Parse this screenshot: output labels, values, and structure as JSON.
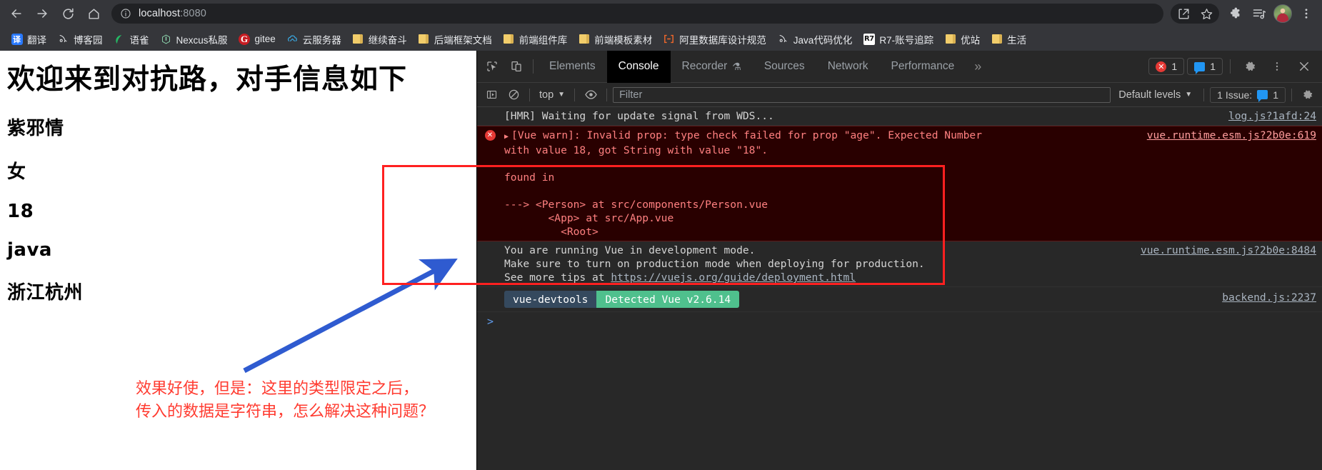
{
  "browser": {
    "nav": {
      "back": "back-arrow",
      "forward": "forward-arrow",
      "reload": "reload",
      "home": "home"
    },
    "omnibox": {
      "info_icon": "site-info-icon",
      "url_host": "localhost",
      "url_port": ":8080",
      "full_url": "localhost:8080"
    },
    "toolbar_right": [
      {
        "name": "share-icon"
      },
      {
        "name": "bookmark-star-icon"
      },
      {
        "name": "extensions-puzzle-icon"
      },
      {
        "name": "media-playlist-icon"
      },
      {
        "name": "profile-avatar"
      },
      {
        "name": "chrome-menu-icon"
      }
    ],
    "bookmarks": [
      {
        "label": "翻译",
        "icon": "translate-icon",
        "glyph": "译"
      },
      {
        "label": "博客园",
        "icon": "cnblogs-icon",
        "glyph": "↘"
      },
      {
        "label": "语雀",
        "icon": "yuque-icon",
        "glyph": "◖"
      },
      {
        "label": "Nexcus私服",
        "icon": "nexus-icon",
        "glyph": "⬡"
      },
      {
        "label": "gitee",
        "icon": "gitee-icon",
        "glyph": "G"
      },
      {
        "label": "云服务器",
        "icon": "cloud-icon",
        "glyph": "◍"
      },
      {
        "label": "继续奋斗",
        "icon": "folder-icon",
        "glyph": ""
      },
      {
        "label": "后端框架文档",
        "icon": "folder-icon",
        "glyph": ""
      },
      {
        "label": "前端组件库",
        "icon": "folder-icon",
        "glyph": ""
      },
      {
        "label": "前端模板素材",
        "icon": "folder-icon",
        "glyph": ""
      },
      {
        "label": "阿里数据库设计规范",
        "icon": "alibaba-icon",
        "glyph": "[-]"
      },
      {
        "label": "Java代码优化",
        "icon": "java-icon",
        "glyph": "↘"
      },
      {
        "label": "R7-账号追踪",
        "icon": "r7-icon",
        "glyph": "R7"
      },
      {
        "label": "优站",
        "icon": "folder-icon",
        "glyph": ""
      },
      {
        "label": "生活",
        "icon": "folder-icon",
        "glyph": ""
      }
    ]
  },
  "page": {
    "heading": "欢迎来到对抗路，对手信息如下",
    "lines": [
      "紫邪情",
      "女",
      "18",
      "java",
      "浙江杭州"
    ],
    "annotation_note": "效果好使，但是：这里的类型限定之后，\n传入的数据是字符串，怎么解决这种问题？",
    "annotation_note_line1": "效果好使，但是：这里的类型限定之后，",
    "annotation_note_line2": "传入的数据是字符串，怎么解决这种问题？",
    "annotation_color": "#ff3b30",
    "arrow_color": "#2f5bd0",
    "highlight_box_color": "#ff2020"
  },
  "devtools": {
    "tool_icons": [
      {
        "name": "inspect-element-icon"
      },
      {
        "name": "device-toolbar-icon"
      }
    ],
    "tabs": [
      {
        "label": "Elements",
        "active": false,
        "badge": ""
      },
      {
        "label": "Console",
        "active": true,
        "badge": ""
      },
      {
        "label": "Recorder",
        "active": false,
        "badge": "⚗"
      },
      {
        "label": "Sources",
        "active": false,
        "badge": ""
      },
      {
        "label": "Network",
        "active": false,
        "badge": ""
      },
      {
        "label": "Performance",
        "active": false,
        "badge": ""
      }
    ],
    "more_tabs_icon": "»",
    "error_count": "1",
    "message_count": "1",
    "settings_icon": "gear-icon",
    "more_options_icon": "kebab-menu-icon",
    "close_icon": "close-icon",
    "filterbar": {
      "sidebar_icon": "console-sidebar-icon",
      "clear_icon": "clear-console-icon",
      "context": "top",
      "eye_icon": "live-expression-icon",
      "filter_placeholder": "Filter",
      "filter_value": "",
      "levels": "Default levels",
      "issues_label": "1 Issue:",
      "issues_count": "1",
      "settings_icon": "console-settings-icon"
    },
    "console": {
      "rows": [
        {
          "type": "info",
          "text": "[HMR] Waiting for update signal from WDS...",
          "source": "log.js?1afd:24"
        },
        {
          "type": "error",
          "text": "[Vue warn]: Invalid prop: type check failed for prop \"age\". Expected Number\nwith value 18, got String with value \"18\".\n\nfound in\n\n---> <Person> at src/components/Person.vue\n       <App> at src/App.vue\n         <Root>",
          "line1": "[Vue warn]: Invalid prop: type check failed for prop \"age\". Expected Number",
          "line2": "with value 18, got String with value \"18\".",
          "line3": "found in",
          "line4": "---> <Person> at src/components/Person.vue",
          "line5": "       <App> at src/App.vue",
          "line6": "         <Root>",
          "source": "vue.runtime.esm.js?2b0e:619"
        },
        {
          "type": "info",
          "line1": "You are running Vue in development mode.",
          "line2": "Make sure to turn on production mode when deploying for production.",
          "line3_pre": "See more tips at ",
          "link": "https://vuejs.org/guide/deployment.html",
          "source": "vue.runtime.esm.js?2b0e:8484"
        }
      ],
      "devtools_badge": {
        "left": "vue-devtools",
        "right": "Detected Vue v2.6.14",
        "left_bg": "#35495e",
        "right_bg": "#4fc08d",
        "source": "backend.js:2237"
      },
      "prompt_symbol": ">"
    }
  }
}
